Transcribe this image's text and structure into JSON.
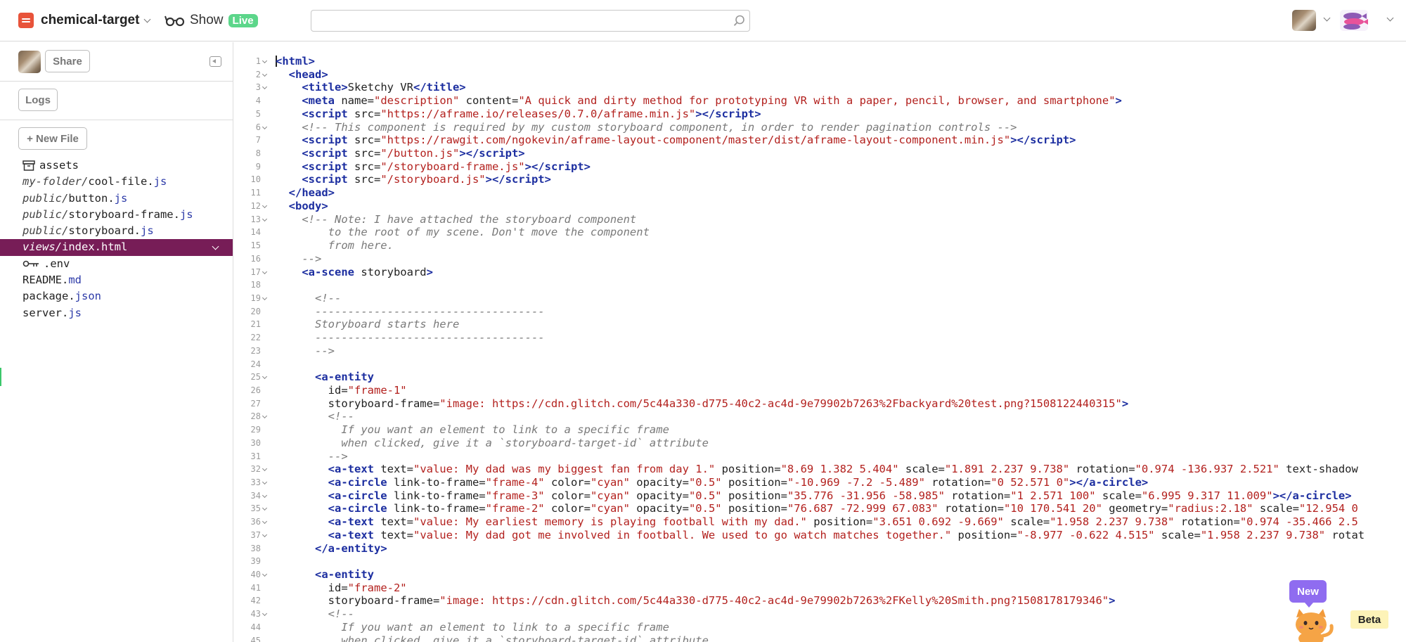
{
  "header": {
    "project_name": "chemical-target",
    "show_label": "Show",
    "live_badge": "Live",
    "search_value": ""
  },
  "sidebar": {
    "share_label": "Share",
    "logs_label": "Logs",
    "new_file_label": "+ New File",
    "files": [
      {
        "dir": "",
        "name": "assets",
        "ext": "",
        "icon": "assets-box-icon",
        "active": false
      },
      {
        "dir": "my-folder/",
        "name": "cool-file.",
        "ext": "js",
        "active": false
      },
      {
        "dir": "public/",
        "name": "button.",
        "ext": "js",
        "active": false
      },
      {
        "dir": "public/",
        "name": "storyboard-frame.",
        "ext": "js",
        "active": false
      },
      {
        "dir": "public/",
        "name": "storyboard.",
        "ext": "js",
        "active": false
      },
      {
        "dir": "views/",
        "name": "index.html",
        "ext": "",
        "active": true
      },
      {
        "dir": "",
        "name": ".env",
        "ext": "",
        "icon": "key-icon",
        "active": false
      },
      {
        "dir": "",
        "name": "README.",
        "ext": "md",
        "active": false
      },
      {
        "dir": "",
        "name": "package.",
        "ext": "json",
        "active": false
      },
      {
        "dir": "",
        "name": "server.",
        "ext": "js",
        "active": false
      }
    ]
  },
  "editor": {
    "lines": [
      {
        "n": 1,
        "fold": true,
        "html": "<span class=\"caret\"></span><span class=\"tag\">&lt;html&gt;</span>"
      },
      {
        "n": 2,
        "fold": true,
        "html": "  <span class=\"tag\">&lt;head&gt;</span>"
      },
      {
        "n": 3,
        "fold": true,
        "html": "    <span class=\"tag\">&lt;title&gt;</span>Sketchy VR<span class=\"tag\">&lt;/title&gt;</span>"
      },
      {
        "n": 4,
        "fold": false,
        "html": "    <span class=\"tag\">&lt;meta</span> name=<span class=\"str\">\"description\"</span> content=<span class=\"str\">\"A quick and dirty method for prototyping VR with a paper, pencil, browser, and smartphone\"</span><span class=\"tag\">&gt;</span>"
      },
      {
        "n": 5,
        "fold": false,
        "html": "    <span class=\"tag\">&lt;script</span> src=<span class=\"str\">\"https://aframe.io/releases/0.7.0/aframe.min.js\"</span><span class=\"tag\">&gt;&lt;/script&gt;</span>"
      },
      {
        "n": 6,
        "fold": true,
        "html": "    <span class=\"cmt\">&lt;!-- This component is required by my custom storyboard component, in order to render pagination controls --&gt;</span>"
      },
      {
        "n": 7,
        "fold": false,
        "html": "    <span class=\"tag\">&lt;script</span> src=<span class=\"str\">\"https://rawgit.com/ngokevin/aframe-layout-component/master/dist/aframe-layout-component.min.js\"</span><span class=\"tag\">&gt;&lt;/script&gt;</span>"
      },
      {
        "n": 8,
        "fold": false,
        "html": "    <span class=\"tag\">&lt;script</span> src=<span class=\"str\">\"/button.js\"</span><span class=\"tag\">&gt;&lt;/script&gt;</span>"
      },
      {
        "n": 9,
        "fold": false,
        "html": "    <span class=\"tag\">&lt;script</span> src=<span class=\"str\">\"/storyboard-frame.js\"</span><span class=\"tag\">&gt;&lt;/script&gt;</span>"
      },
      {
        "n": 10,
        "fold": false,
        "html": "    <span class=\"tag\">&lt;script</span> src=<span class=\"str\">\"/storyboard.js\"</span><span class=\"tag\">&gt;&lt;/script&gt;</span>"
      },
      {
        "n": 11,
        "fold": false,
        "html": "  <span class=\"tag\">&lt;/head&gt;</span>"
      },
      {
        "n": 12,
        "fold": true,
        "html": "  <span class=\"tag\">&lt;body&gt;</span>"
      },
      {
        "n": 13,
        "fold": true,
        "html": "    <span class=\"cmt\">&lt;!-- Note: I have attached the storyboard component</span>"
      },
      {
        "n": 14,
        "fold": false,
        "html": "<span class=\"cmt\">        to the root of my scene. Don't move the component</span>"
      },
      {
        "n": 15,
        "fold": false,
        "html": "<span class=\"cmt\">        from here.</span>"
      },
      {
        "n": 16,
        "fold": false,
        "html": "<span class=\"cmt\">    --&gt;</span>"
      },
      {
        "n": 17,
        "fold": true,
        "html": "    <span class=\"tag\">&lt;a-scene</span> storyboard<span class=\"tag\">&gt;</span>"
      },
      {
        "n": 18,
        "fold": false,
        "html": ""
      },
      {
        "n": 19,
        "fold": true,
        "html": "      <span class=\"cmt\">&lt;!--</span>"
      },
      {
        "n": 20,
        "fold": false,
        "html": "<span class=\"cmt\">      -----------------------------------</span>"
      },
      {
        "n": 21,
        "fold": false,
        "html": "<span class=\"cmt\">      Storyboard starts here</span>"
      },
      {
        "n": 22,
        "fold": false,
        "html": "<span class=\"cmt\">      -----------------------------------</span>"
      },
      {
        "n": 23,
        "fold": false,
        "html": "<span class=\"cmt\">      --&gt;</span>"
      },
      {
        "n": 24,
        "fold": false,
        "html": ""
      },
      {
        "n": 25,
        "fold": true,
        "html": "      <span class=\"tag\">&lt;a-entity</span>"
      },
      {
        "n": 26,
        "fold": false,
        "html": "        id=<span class=\"str\">\"frame-1\"</span>"
      },
      {
        "n": 27,
        "fold": false,
        "html": "        storyboard-frame=<span class=\"str\">\"image: https://cdn.glitch.com/5c44a330-d775-40c2-ac4d-9e79902b7263%2Fbackyard%20test.png?1508122440315\"</span><span class=\"tag\">&gt;</span>"
      },
      {
        "n": 28,
        "fold": true,
        "html": "        <span class=\"cmt\">&lt;!--</span>"
      },
      {
        "n": 29,
        "fold": false,
        "html": "<span class=\"cmt\">          If you want an element to link to a specific frame</span>"
      },
      {
        "n": 30,
        "fold": false,
        "html": "<span class=\"cmt\">          when clicked, give it a `storyboard-target-id` attribute</span>"
      },
      {
        "n": 31,
        "fold": false,
        "html": "<span class=\"cmt\">        --&gt;</span>"
      },
      {
        "n": 32,
        "fold": true,
        "html": "        <span class=\"tag\">&lt;a-text</span> text=<span class=\"str\">\"value: My dad was my biggest fan from day 1.\"</span> position=<span class=\"str\">\"8.69 1.382 5.404\"</span> scale=<span class=\"str\">\"1.891 2.237 9.738\"</span> rotation=<span class=\"str\">\"0.974 -136.937 2.521\"</span> text-shadow"
      },
      {
        "n": 33,
        "fold": true,
        "html": "        <span class=\"tag\">&lt;a-circle</span> link-to-frame=<span class=\"str\">\"frame-4\"</span> color=<span class=\"str\">\"cyan\"</span> opacity=<span class=\"str\">\"0.5\"</span> position=<span class=\"str\">\"-10.969 -7.2 -5.489\"</span> rotation=<span class=\"str\">\"0 52.571 0\"</span><span class=\"tag\">&gt;&lt;/a-circle&gt;</span>"
      },
      {
        "n": 34,
        "fold": true,
        "html": "        <span class=\"tag\">&lt;a-circle</span> link-to-frame=<span class=\"str\">\"frame-3\"</span> color=<span class=\"str\">\"cyan\"</span> opacity=<span class=\"str\">\"0.5\"</span> position=<span class=\"str\">\"35.776 -31.956 -58.985\"</span> rotation=<span class=\"str\">\"1 2.571 100\"</span> scale=<span class=\"str\">\"6.995 9.317 11.009\"</span><span class=\"tag\">&gt;&lt;/a-circle&gt;</span>"
      },
      {
        "n": 35,
        "fold": true,
        "html": "        <span class=\"tag\">&lt;a-circle</span> link-to-frame=<span class=\"str\">\"frame-2\"</span> color=<span class=\"str\">\"cyan\"</span> opacity=<span class=\"str\">\"0.5\"</span> position=<span class=\"str\">\"76.687 -72.999 67.083\"</span> rotation=<span class=\"str\">\"10 170.541 20\"</span> geometry=<span class=\"str\">\"radius:2.18\"</span> scale=<span class=\"str\">\"12.954 0</span>"
      },
      {
        "n": 36,
        "fold": true,
        "html": "        <span class=\"tag\">&lt;a-text</span> text=<span class=\"str\">\"value: My earliest memory is playing football with my dad.\"</span> position=<span class=\"str\">\"3.651 0.692 -9.669\"</span> scale=<span class=\"str\">\"1.958 2.237 9.738\"</span> rotation=<span class=\"str\">\"0.974 -35.466 2.5</span>"
      },
      {
        "n": 37,
        "fold": true,
        "html": "        <span class=\"tag\">&lt;a-text</span> text=<span class=\"str\">\"value: My dad got me involved in football. We used to go watch matches together.\"</span> position=<span class=\"str\">\"-8.977 -0.622 4.515\"</span> scale=<span class=\"str\">\"1.958 2.237 9.738\"</span> rotat"
      },
      {
        "n": 38,
        "fold": false,
        "html": "      <span class=\"tag\">&lt;/a-entity&gt;</span>"
      },
      {
        "n": 39,
        "fold": false,
        "html": ""
      },
      {
        "n": 40,
        "fold": true,
        "html": "      <span class=\"tag\">&lt;a-entity</span>"
      },
      {
        "n": 41,
        "fold": false,
        "html": "        id=<span class=\"str\">\"frame-2\"</span>"
      },
      {
        "n": 42,
        "fold": false,
        "html": "        storyboard-frame=<span class=\"str\">\"image: https://cdn.glitch.com/5c44a330-d775-40c2-ac4d-9e79902b7263%2FKelly%20Smith.png?1508178179346\"</span><span class=\"tag\">&gt;</span>"
      },
      {
        "n": 43,
        "fold": true,
        "html": "        <span class=\"cmt\">&lt;!--</span>"
      },
      {
        "n": 44,
        "fold": false,
        "html": "<span class=\"cmt\">          If you want an element to link to a specific frame</span>"
      },
      {
        "n": 45,
        "fold": false,
        "html": "<span class=\"cmt\">          when clicked, give it a `storyboard-target-id` attribute</span>"
      }
    ]
  },
  "widgets": {
    "new_label": "New",
    "beta_label": "Beta"
  }
}
